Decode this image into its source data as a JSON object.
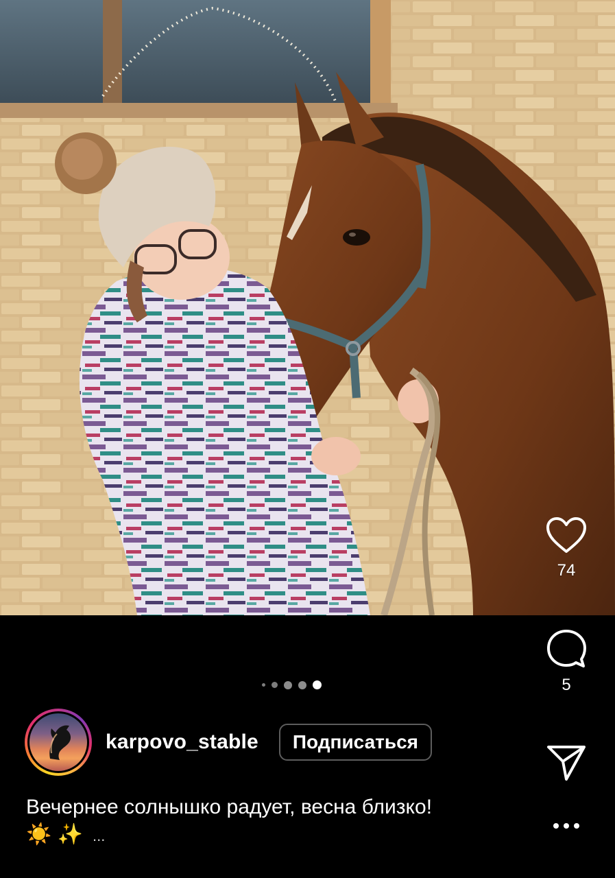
{
  "post": {
    "username": "karpovo_stable",
    "follow_label": "Подписаться",
    "caption_line1": "Вечернее солнышко радует, весна близко!",
    "caption_emojis": "☀️ ✨",
    "caption_more": "...",
    "likes": "74",
    "comments": "5"
  },
  "carousel": {
    "total_visible_dots": 5,
    "active_index": 4
  },
  "icons": {
    "like": "heart-icon",
    "comment": "comment-icon",
    "share": "send-icon",
    "more": "more-icon",
    "avatar": "horse-head-logo"
  },
  "colors": {
    "background": "#000000",
    "text": "#ffffff",
    "story_ring": [
      "#f9d423",
      "#e1306c",
      "#833ab4"
    ],
    "inactive_dot": "#7d7d7d",
    "active_dot": "#ffffff"
  }
}
